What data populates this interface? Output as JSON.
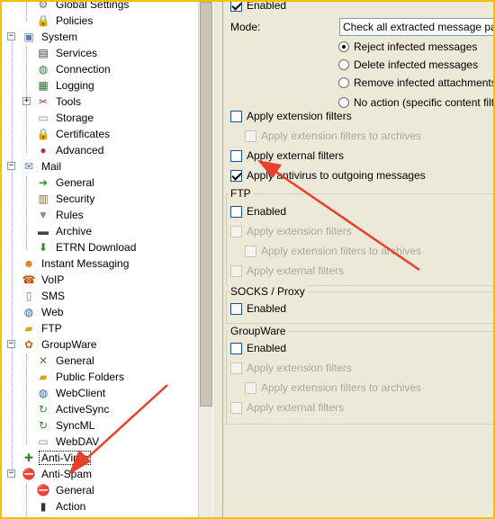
{
  "tree": {
    "items": [
      {
        "label": "Global Settings",
        "icon": "global-settings-icon",
        "glyph": "⚙",
        "color": "#6d6d6d"
      },
      {
        "label": "Policies",
        "icon": "policies-icon",
        "glyph": "🔒",
        "color": "#444"
      },
      {
        "label": "System",
        "icon": "system-icon",
        "glyph": "▣",
        "color": "#5b7fb8"
      },
      {
        "label": "Services",
        "icon": "services-icon",
        "glyph": "▤",
        "color": "#333"
      },
      {
        "label": "Connection",
        "icon": "connection-icon",
        "glyph": "◍",
        "color": "#2b7a3f"
      },
      {
        "label": "Logging",
        "icon": "logging-icon",
        "glyph": "▦",
        "color": "#2b6b2b"
      },
      {
        "label": "Tools",
        "icon": "tools-icon",
        "glyph": "✂",
        "color": "#b03030"
      },
      {
        "label": "Storage",
        "icon": "storage-icon",
        "glyph": "▭",
        "color": "#888"
      },
      {
        "label": "Certificates",
        "icon": "certificates-icon",
        "glyph": "🔒",
        "color": "#c03030"
      },
      {
        "label": "Advanced",
        "icon": "advanced-icon",
        "glyph": "●",
        "color": "#c03030"
      },
      {
        "label": "Mail",
        "icon": "mail-icon",
        "glyph": "✉",
        "color": "#5677a6"
      },
      {
        "label": "General",
        "icon": "mail-general-icon",
        "glyph": "➔",
        "color": "#2e8b2e"
      },
      {
        "label": "Security",
        "icon": "mail-security-icon",
        "glyph": "▥",
        "color": "#8a6a3a"
      },
      {
        "label": "Rules",
        "icon": "rules-icon",
        "glyph": "▼",
        "color": "#888"
      },
      {
        "label": "Archive",
        "icon": "archive-icon",
        "glyph": "▬",
        "color": "#444"
      },
      {
        "label": "ETRN Download",
        "icon": "etrn-download-icon",
        "glyph": "⬇",
        "color": "#2e8b2e"
      },
      {
        "label": "Instant Messaging",
        "icon": "instant-messaging-icon",
        "glyph": "☻",
        "color": "#e07a00"
      },
      {
        "label": "VoIP",
        "icon": "voip-icon",
        "glyph": "☎",
        "color": "#c05000"
      },
      {
        "label": "SMS",
        "icon": "sms-icon",
        "glyph": "▯",
        "color": "#5a7fa8"
      },
      {
        "label": "Web",
        "icon": "web-icon",
        "glyph": "◍",
        "color": "#2b6ab0"
      },
      {
        "label": "FTP",
        "icon": "ftp-icon",
        "glyph": "▰",
        "color": "#d9a400"
      },
      {
        "label": "GroupWare",
        "icon": "groupware-icon",
        "glyph": "✿",
        "color": "#c07020"
      },
      {
        "label": "General",
        "icon": "groupware-general-icon",
        "glyph": "✕",
        "color": "#8a6a3a"
      },
      {
        "label": "Public Folders",
        "icon": "public-folders-icon",
        "glyph": "▰",
        "color": "#d9a400"
      },
      {
        "label": "WebClient",
        "icon": "webclient-icon",
        "glyph": "◍",
        "color": "#2b6ab0"
      },
      {
        "label": "ActiveSync",
        "icon": "activesync-icon",
        "glyph": "↻",
        "color": "#2e8b2e"
      },
      {
        "label": "SyncML",
        "icon": "syncml-icon",
        "glyph": "↻",
        "color": "#2e8b2e"
      },
      {
        "label": "WebDAV",
        "icon": "webdav-icon",
        "glyph": "▭",
        "color": "#888"
      },
      {
        "label": "Anti-Virus",
        "icon": "anti-virus-icon",
        "glyph": "✚",
        "color": "#2e8b2e"
      },
      {
        "label": "Anti-Spam",
        "icon": "anti-spam-icon",
        "glyph": "⛔",
        "color": "#c00000"
      },
      {
        "label": "General",
        "icon": "anti-spam-general-icon",
        "glyph": "⛔",
        "color": "#c00000"
      },
      {
        "label": "Action",
        "icon": "action-icon",
        "glyph": "▮",
        "color": "#333"
      }
    ]
  },
  "panel": {
    "top_enabled": "Enabled",
    "mode_label": "Mode:",
    "mode_value": "Check all extracted message parts a",
    "radios": [
      "Reject infected messages",
      "Delete infected messages",
      "Remove infected attachments",
      "No action (specific content filter n"
    ],
    "apply_extension_filters": "Apply extension filters",
    "apply_extension_filters_archives": "Apply extension filters to archives",
    "apply_external_filters": "Apply external filters",
    "apply_antivirus_outgoing": "Apply antivirus to outgoing messages",
    "ftp": {
      "title": "FTP",
      "enabled": "Enabled",
      "ext": "Apply extension filters",
      "ext_archives": "Apply extension filters to archives",
      "external": "Apply external filters"
    },
    "socks": {
      "title": "SOCKS / Proxy",
      "enabled": "Enabled"
    },
    "groupware": {
      "title": "GroupWare",
      "enabled": "Enabled",
      "ext": "Apply extension filters",
      "ext_archives": "Apply extension filters to archives",
      "external": "Apply external filters"
    }
  },
  "colors": {
    "highlight_border": "#f2c200",
    "arrow": "#e8402a",
    "panel_bg": "#ece9d8"
  }
}
